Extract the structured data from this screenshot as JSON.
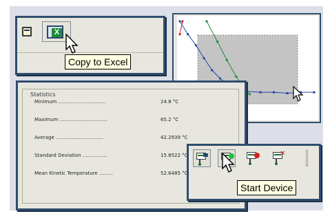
{
  "toolbar": {
    "buttons": [
      {
        "icon": "sheet-icon"
      },
      {
        "icon": "excel-icon"
      }
    ],
    "excel_glyph": "X",
    "tooltip": "Copy to Excel"
  },
  "statistics": {
    "group_title": "Statistics",
    "rows": [
      {
        "label": "Minimum ...............................",
        "value": "24.8 °C"
      },
      {
        "label": "Maximum ...............................",
        "value": "65.2 °C"
      },
      {
        "label": "Average ...............................",
        "value": "42.2939 °C"
      },
      {
        "label": "Standard Deviation ................",
        "value": "15.8522 °C"
      },
      {
        "label": "Mean Kinetic Temperature .........",
        "value": "52.6485 °C"
      }
    ]
  },
  "device_toolbar": {
    "buttons": [
      {
        "icon": "device-settings-icon"
      },
      {
        "icon": "start-device-icon"
      },
      {
        "icon": "stop-device-icon"
      },
      {
        "icon": "delete-device-icon"
      }
    ],
    "tooltip": "Start Device"
  },
  "chart_data": {
    "type": "line",
    "grid": false,
    "selection_rectangle": true,
    "series": [
      {
        "color": "#2244aa",
        "points": [
          [
            0.0,
            1.0
          ],
          [
            0.06,
            0.86
          ],
          [
            0.12,
            0.74
          ],
          [
            0.18,
            0.6
          ],
          [
            0.24,
            0.47
          ],
          [
            0.3,
            0.38
          ],
          [
            0.36,
            0.31
          ],
          [
            0.42,
            0.27
          ],
          [
            0.5,
            0.24
          ],
          [
            0.6,
            0.23
          ],
          [
            0.7,
            0.23
          ],
          [
            0.8,
            0.22
          ],
          [
            0.9,
            0.23
          ],
          [
            1.0,
            0.23
          ]
        ]
      },
      {
        "color": "#1f8c3a",
        "points": [
          [
            0.2,
            1.0
          ],
          [
            0.28,
            0.78
          ],
          [
            0.35,
            0.58
          ],
          [
            0.42,
            0.4
          ],
          [
            0.48,
            0.27
          ],
          [
            0.52,
            0.21
          ]
        ]
      },
      {
        "color": "#d42020",
        "points": [
          [
            0.0,
            0.86
          ],
          [
            0.02,
            1.0
          ]
        ]
      }
    ],
    "colors": {
      "blue": "#2244aa",
      "green": "#1f8c3a",
      "red": "#d42020"
    }
  }
}
